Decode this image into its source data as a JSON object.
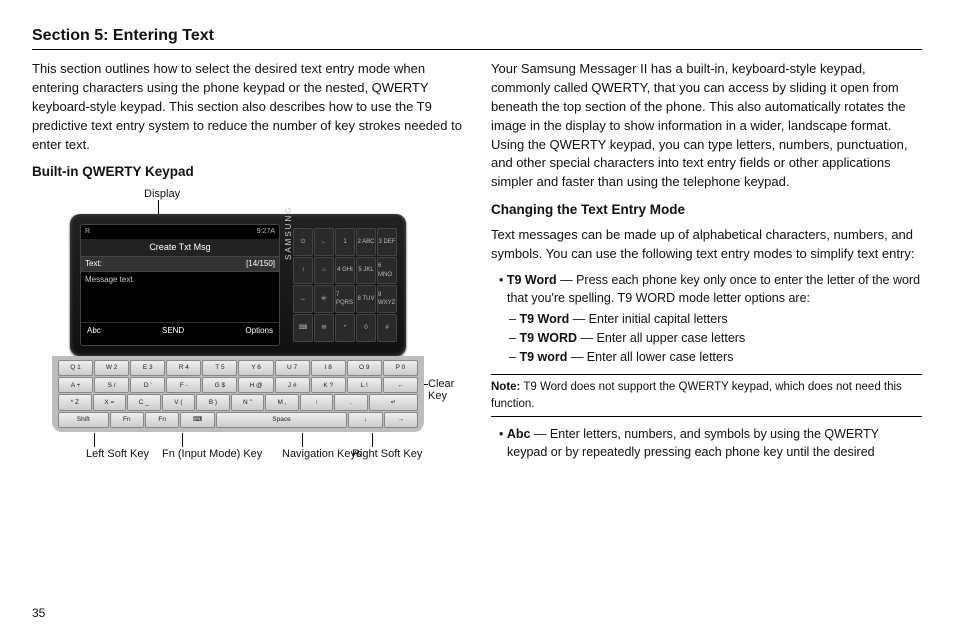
{
  "page_number": "35",
  "section_title": "Section 5: Entering Text",
  "left": {
    "intro": "This section outlines how to select the desired text entry mode when entering characters using the phone keypad or the nested, QWERTY keyboard-style keypad. This section also describes how to use the T9 predictive text entry system to reduce the number of key strokes needed to enter text.",
    "heading": "Built-in QWERTY Keypad",
    "labels": {
      "display": "Display",
      "clear_key": "Clear Key",
      "left_soft": "Left Soft Key",
      "fn": "Fn (Input Mode) Key",
      "nav": "Navigation Keys",
      "right_soft": "Right Soft Key"
    },
    "screen": {
      "status_left": "R",
      "status_right": "9:27A",
      "title": "Create Txt Msg",
      "row_label": "Text:",
      "row_count": "[14/150]",
      "body": "Message text.",
      "soft_left": "Abc",
      "soft_mid": "SEND",
      "soft_right": "Options",
      "brand": "SAMSUNG"
    },
    "qwerty_rows": [
      [
        "Q 1",
        "W 2",
        "E 3",
        "R 4",
        "T 5",
        "Y 6",
        "U 7",
        "I 8",
        "O 9",
        "P 0"
      ],
      [
        "A +",
        "S /",
        "D '",
        "F -",
        "G $",
        "H @",
        "J #",
        "K ?",
        "L !",
        "←"
      ],
      [
        "* Z",
        "X =",
        "C _",
        "V (",
        "B )",
        "N \"",
        "M ,",
        "↑",
        ".",
        "↵"
      ],
      [
        "Shift",
        "Fn",
        "Fn",
        "⌨",
        "Space",
        "Space",
        "Space",
        "Space",
        "↓",
        "→"
      ]
    ],
    "hardkeys": [
      "⏻",
      "←",
      "1",
      "2 ABC",
      "3 DEF",
      "↕",
      "⌂",
      "4 GHI",
      "5 JKL",
      "6 MNO",
      "↔",
      "⎆",
      "7 PQRS",
      "8 TUV",
      "9 WXYZ",
      "⌨",
      "✉",
      "*",
      "0",
      "#"
    ]
  },
  "right": {
    "para": "Your Samsung Messager II has a built-in, keyboard-style keypad, commonly called QWERTY, that you can access by sliding it open from beneath the top section of the phone. This also automatically rotates the image in the display to show information in a wider, landscape format. Using the QWERTY keypad, you can type letters, numbers, punctuation, and other special characters into text entry fields or other applications simpler and faster than using the telephone keypad.",
    "heading": "Changing the Text Entry Mode",
    "para2": "Text messages can be made up of alphabetical characters, numbers, and symbols. You can use the following text entry modes to simplify text entry:",
    "bullet_t9_label": "T9 Word",
    "bullet_t9_text": " — Press each phone key only once to enter the letter of the word that you're spelling. T9 WORD mode letter options are:",
    "sub": [
      {
        "l": "T9 Word",
        "t": " — Enter initial capital letters"
      },
      {
        "l": "T9 WORD",
        "t": " — Enter all upper case letters"
      },
      {
        "l": "T9 word",
        "t": " — Enter all lower case letters"
      }
    ],
    "note_label": "Note:",
    "note_text": " T9 Word does not support the QWERTY keypad, which does not need this function.",
    "bullet_abc_label": "Abc",
    "bullet_abc_text": " — Enter letters, numbers, and symbols by using the QWERTY keypad or by repeatedly pressing each phone key until the desired"
  }
}
